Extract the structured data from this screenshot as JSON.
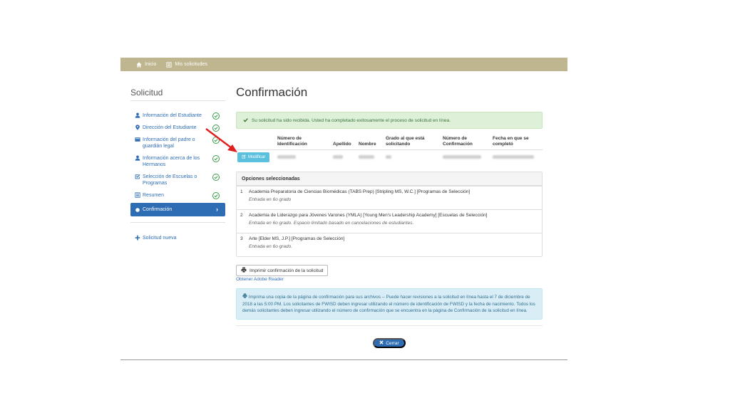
{
  "nav": {
    "home": "Inicio",
    "my_apps": "Mis solicitudes"
  },
  "sidebar": {
    "title": "Solicitud",
    "items": [
      {
        "label": "Información del Estudiante",
        "icon": "user-icon",
        "done": true
      },
      {
        "label": "Dirección del Estudiante",
        "icon": "map-marker-icon",
        "done": true
      },
      {
        "label": "Información del padre o guardián legal",
        "icon": "id-card-icon",
        "done": true
      },
      {
        "label": "Información acerca de los Hermanos",
        "icon": "user-icon",
        "done": true
      },
      {
        "label": "Selección de Escuelas o Programas",
        "icon": "checkbox-icon",
        "done": true
      },
      {
        "label": "Resumen",
        "icon": "list-icon",
        "done": true
      },
      {
        "label": "Confirmación",
        "icon": "circle-icon",
        "active": true
      }
    ],
    "new_app": "Solicitud nueva"
  },
  "main": {
    "title": "Confirmación",
    "success_message": "Su solicitud ha sido recibida. Usted ha completado exitosamente el proceso de solicitud en línea.",
    "table": {
      "headers": [
        "Número de Identificación",
        "Apellido",
        "Nombre",
        "Grado al que está solicitando",
        "Número de Confirmación",
        "Fecha en que se completó"
      ],
      "modify_label": "Modificar"
    },
    "options": {
      "heading": "Opciones seleccionadas",
      "items": [
        {
          "num": "1",
          "title": "Academia Preparatoria de Ciencias Biomédicas (TABS Prep) [Stripling MS, W.C.] [Programas de Selección]",
          "sub": "Entrada en 6o grado"
        },
        {
          "num": "2",
          "title": "Academia de Liderazgo para Jóvenes Varones (YMLA) [Young Men's Leadership Academy] [Escuelas de Selección]",
          "sub": "Entrada en 6o grado. Espacio limitado basado en cancelaciones de estudiantes."
        },
        {
          "num": "3",
          "title": "Arte [Elder MS, J.P.] [Programas de Selección]",
          "sub": "Entrada en 6o grado."
        }
      ]
    },
    "print_label": "Imprimir confirmación de la solicitud",
    "adobe_label": "Obtener Adobe Reader",
    "info_text": "Imprima una copia de la página de confirmación para sus archivos -- Puede hacer revisiones a la solicitud en línea hasta el 7 de diciembre de 2018 a las 5:00 PM. Los solicitantes de FWISD deben ingresar utilizando el número de identificación de FWISD y la fecha de nacimiento. Todos los demás solicitantes deben ingresar utilizando el número de confirmación que se encuentra en la página de Confirmación de la solicitud en línea.",
    "close_label": "Cerrar"
  },
  "colors": {
    "topbar": "#bfb58f",
    "primary": "#2e6db4",
    "success": "#3a9a4a",
    "annotation_arrow": "#e02020"
  }
}
